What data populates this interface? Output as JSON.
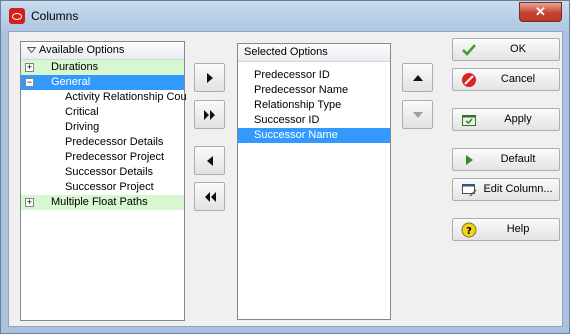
{
  "window": {
    "title": "Columns",
    "close_glyph": "✕"
  },
  "available": {
    "header": "Available Options",
    "groups": [
      {
        "label": "Durations",
        "expander": "+",
        "selected": false,
        "children": []
      },
      {
        "label": "General",
        "expander": "−",
        "selected": true,
        "children": [
          "Activity Relationship Cou",
          "Critical",
          "Driving",
          "Predecessor Details",
          "Predecessor Project",
          "Successor Details",
          "Successor Project"
        ]
      },
      {
        "label": "Multiple Float Paths",
        "expander": "+",
        "selected": false,
        "children": []
      }
    ]
  },
  "selected": {
    "header": "Selected Options",
    "items": [
      "Predecessor ID",
      "Predecessor Name",
      "Relationship Type",
      "Successor ID",
      "Successor Name"
    ],
    "selected_index": 4
  },
  "transfer_buttons": [
    {
      "name": "add-selected-button",
      "icon": "arrow-right-icon"
    },
    {
      "name": "add-all-button",
      "icon": "double-arrow-right-icon"
    },
    {
      "name": "remove-selected-button",
      "icon": "arrow-left-icon"
    },
    {
      "name": "remove-all-button",
      "icon": "double-arrow-left-icon"
    }
  ],
  "order_buttons": [
    {
      "name": "move-up-button",
      "icon": "arrow-up-icon",
      "enabled": true
    },
    {
      "name": "move-down-button",
      "icon": "arrow-down-icon",
      "enabled": false
    }
  ],
  "actions": {
    "ok": "OK",
    "cancel": "Cancel",
    "apply": "Apply",
    "default": "Default",
    "edit_column": "Edit Column...",
    "help": "Help"
  },
  "colors": {
    "selection": "#3399ff",
    "group_background": "#d7f7d0",
    "ok_check": "#3b9e2a",
    "cancel_red": "#d8261b",
    "help_yellow": "#f2d41c"
  }
}
